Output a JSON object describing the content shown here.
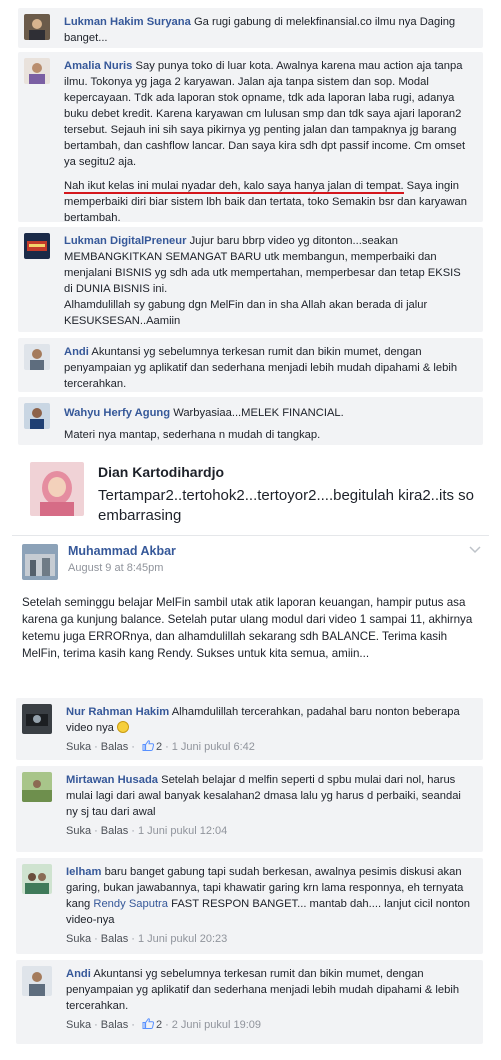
{
  "comments_top": [
    {
      "name": "Lukman Hakim Suryana",
      "text": "Ga rugi gabung di melekfinansial.co ilmu nya Daging banget..."
    },
    {
      "name": "Amalia Nuris",
      "text": "Say punya toko di luar kota. Awalnya karena mau action aja tanpa ilmu. Tokonya yg jaga 2 karyawan. Jalan aja tanpa sistem dan sop. Modal kepercayaan. Tdk ada laporan stok opname, tdk ada laporan laba rugi, adanya buku debet kredit. Karena karyawan cm lulusan smp dan tdk saya ajari laporan2 tersebut. Sejauh ini sih saya pikirnya yg penting jalan dan tampaknya jg barang bertambah, dan cashflow lancar. Dan saya kira sdh dpt passif income. Cm omset ya segitu2 aja.",
      "text2_underlined": "Nah ikut kelas ini mulai nyadar deh, kalo saya hanya jalan di tempat.",
      "text2_rest": " Saya ingin memperbaiki diri biar sistem lbh baik dan tertata, toko Semakin bsr dan karyawan bertambah."
    },
    {
      "name": "Lukman DigitalPreneur",
      "text": "Jujur baru bbrp video yg ditonton...seakan MEMBANGKITKAN SEMANGAT BARU utk membangun, memperbaiki dan menjalani BISNIS yg sdh ada utk mempertahan, memperbesar dan tetap EKSIS di DUNIA BISNIS ini.",
      "text2": "Alhamdulillah sy gabung dgn MelFin dan in sha Allah akan berada di jalur KESUKSESAN..Aamiin"
    },
    {
      "name": "Andi",
      "text": "Akuntansi yg sebelumnya terkesan rumit dan bikin mumet, dengan penyampaian yg aplikatif dan sederhana menjadi lebih mudah dipahami & lebih tercerahkan."
    },
    {
      "name": "Wahyu Herfy Agung",
      "text": "Warbyasiaa...MELEK FINANCIAL.",
      "text2": "Materi nya mantap, sederhana n mudah di tangkap."
    }
  ],
  "big_post": {
    "name": "Dian Kartodihardjo",
    "text": "Tertampar2..tertohok2...tertoyor2....begitulah kira2..its so embarrasing"
  },
  "main_post": {
    "name": "Muhammad Akbar",
    "date": "August 9 at 8:45pm",
    "text": "Setelah seminggu belajar MelFin sambil utak atik laporan keuangan, hampir putus asa karena ga kunjung balance. Setelah putar ulang modul dari video 1 sampai 11, akhirnya ketemu juga ERRORnya, dan alhamdulillah sekarang sdh BALANCE. Terima kasih MelFin, terima kasih kang Rendy. Sukses untuk kita semua, amiin..."
  },
  "comments_bottom": [
    {
      "name": "Nur Rahman Hakim",
      "text": "Alhamdulillah tercerahkan, padahal baru nonton beberapa video nya",
      "like": "Suka",
      "reply": "Balas",
      "likes": "2",
      "time": "1 Juni pukul 6:42"
    },
    {
      "name": "Mirtawan Husada",
      "text": "Setelah belajar d melfin seperti d spbu mulai dari nol, harus mulai lagi dari awal banyak kesalahan2 dmasa lalu yg harus d perbaiki, seandai ny sj tau dari awal",
      "like": "Suka",
      "reply": "Balas",
      "time": "1 Juni pukul 12:04"
    },
    {
      "name": "Ielham",
      "text_a": "baru banget gabung tapi sudah berkesan, awalnya pesimis diskusi akan garing, bukan jawabannya, tapi khawatir garing krn lama responnya, eh ternyata kang ",
      "mention": "Rendy Saputra",
      "text_b": " FAST RESPON BANGET... mantab dah.... lanjut cicil nonton video-nya",
      "like": "Suka",
      "reply": "Balas",
      "time": "1 Juni pukul 20:23"
    },
    {
      "name": "Andi",
      "text": "Akuntansi yg sebelumnya terkesan rumit dan bikin mumet, dengan penyampaian yg aplikatif dan sederhana menjadi lebih mudah dipahami & lebih tercerahkan.",
      "like": "Suka",
      "reply": "Balas",
      "likes": "2",
      "time": "2 Juni pukul 19:09"
    }
  ],
  "colors": {
    "link": "#365899",
    "bubble": "#f2f3f5",
    "underline": "#d4161c"
  }
}
